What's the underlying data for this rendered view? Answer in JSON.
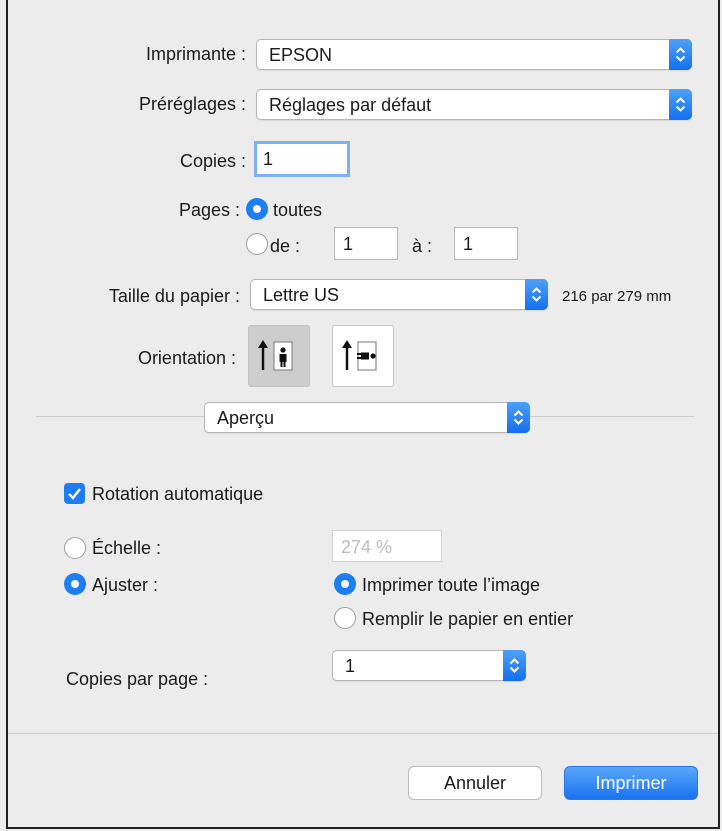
{
  "printer": {
    "label": "Imprimante :",
    "value": "EPSON"
  },
  "presets": {
    "label": "Préréglages :",
    "value": "Réglages par défaut"
  },
  "copies": {
    "label": "Copies :",
    "value": "1"
  },
  "pages": {
    "label": "Pages :",
    "all_label": "toutes",
    "from_label": "de :",
    "from_value": "1",
    "to_label": "à :",
    "to_value": "1",
    "selected": "toutes"
  },
  "paper": {
    "label": "Taille du papier :",
    "value": "Lettre US",
    "size_text": "216 par 279 mm"
  },
  "orientation": {
    "label": "Orientation :",
    "selected": "portrait"
  },
  "section": {
    "value": "Aperçu"
  },
  "preview": {
    "auto_rotate_label": "Rotation automatique",
    "auto_rotate_checked": true,
    "scale_label": "Échelle :",
    "scale_value": "274 %",
    "fit_label": "Ajuster :",
    "fit_selected": true,
    "print_entire_label": "Imprimer toute l’image",
    "fill_paper_label": "Remplir le papier en entier",
    "copies_per_page_label": "Copies par page :",
    "copies_per_page_value": "1"
  },
  "buttons": {
    "cancel": "Annuler",
    "print": "Imprimer"
  },
  "colors": {
    "accent": "#1d7df3",
    "background": "#ececec"
  },
  "icons": [
    "chevron-updown-icon",
    "portrait-orientation-icon",
    "landscape-orientation-icon",
    "checkmark-icon"
  ]
}
